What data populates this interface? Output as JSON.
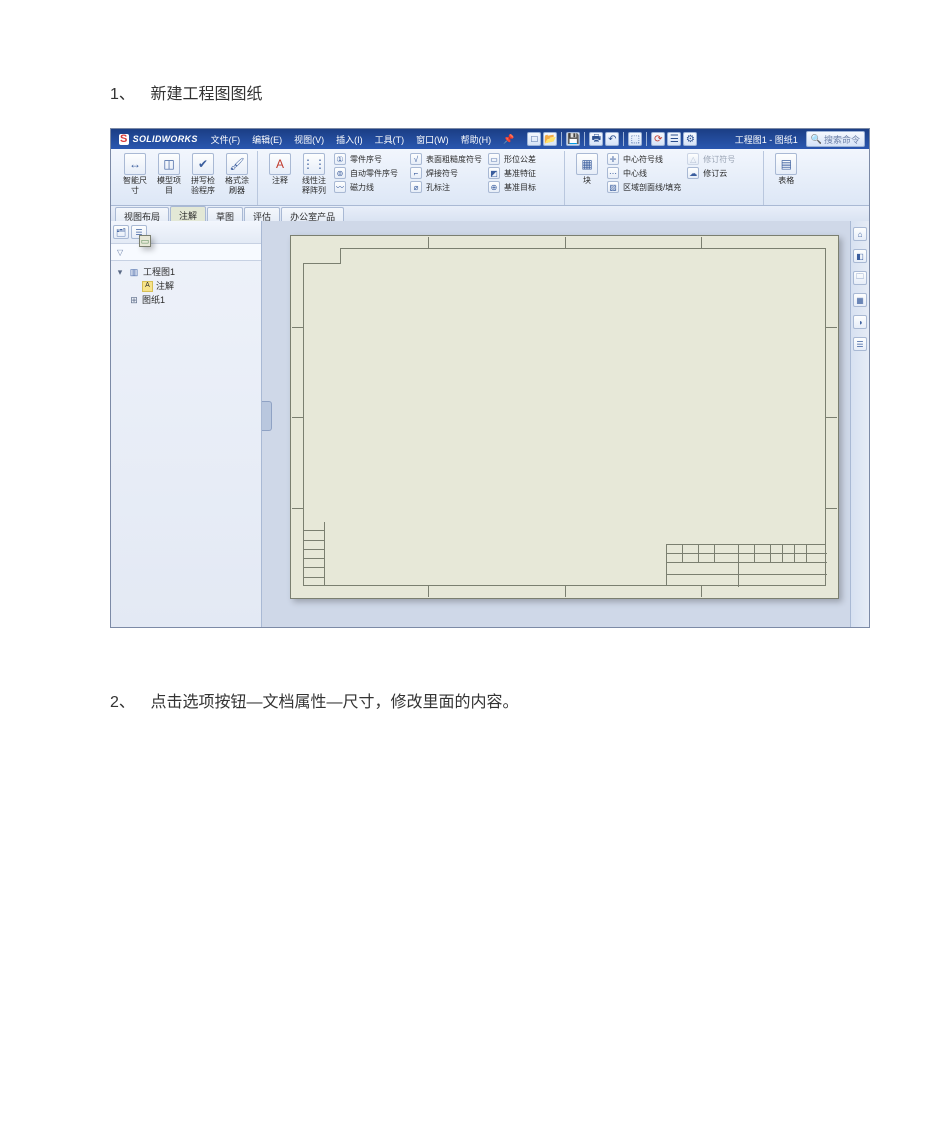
{
  "doc": {
    "step1_num": "1、",
    "step1_text": "新建工程图图纸",
    "step2_num": "2、",
    "step2_text": "点击选项按钮—文档属性—尺寸，修改里面的内容。"
  },
  "sw": {
    "app_name": "SOLIDWORKS",
    "menus": {
      "file": "文件(F)",
      "edit": "编辑(E)",
      "view": "视图(V)",
      "insert": "插入(I)",
      "tools": "工具(T)",
      "window": "窗口(W)",
      "help": "帮助(H)"
    },
    "titlebar": "工程图1 - 图纸1",
    "search_placeholder": "搜索命令",
    "ribbon": {
      "smart_dim": {
        "label1": "智能尺",
        "label2": "寸"
      },
      "model_items": {
        "label1": "模型项",
        "label2": "目"
      },
      "spell": {
        "label1": "拼写检",
        "label2": "验程序"
      },
      "format_painter": {
        "label1": "格式涂",
        "label2": "刷器"
      },
      "note": {
        "label": "注释"
      },
      "linear_pattern": {
        "label1": "线性注",
        "label2": "释阵列"
      },
      "balloon": "零件序号",
      "auto_balloon": "自动零件序号",
      "magnetic_line": "磁力线",
      "surface_finish": "表面粗糙度符号",
      "weld_symbol": "焊接符号",
      "hole_callout": "孔标注",
      "geom_tol": "形位公差",
      "datum_feature": "基准特征",
      "datum_target": "基准目标",
      "blocks": {
        "label1": "块"
      },
      "center_mark": "中心符号线",
      "centerline": "中心线",
      "area_hatch": "区域剖面线/填充",
      "rev_symbol": "修订符号",
      "rev_cloud": "修订云",
      "tables": {
        "label1": "表格"
      }
    },
    "tabs": {
      "view_layout": "视图布局",
      "annotate": "注解",
      "sketch": "草图",
      "evaluate": "评估",
      "office": "办公室产品"
    },
    "tree": {
      "root": "工程图1",
      "annotations": "注解",
      "sheet": "图纸1"
    }
  }
}
